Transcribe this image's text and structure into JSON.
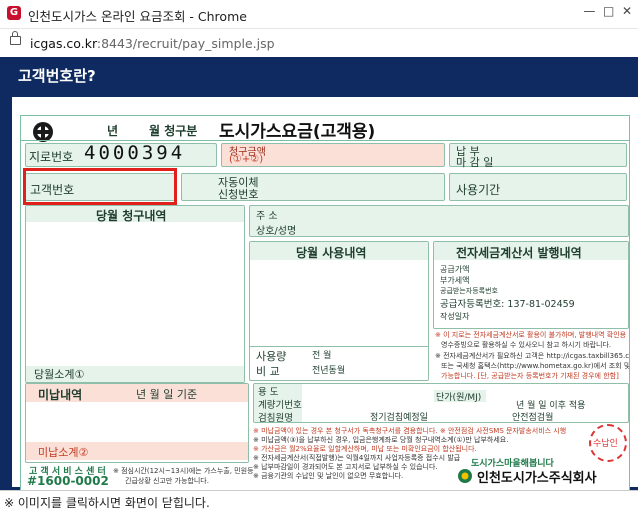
{
  "window": {
    "title": "인천도시가스 온라인 요금조회 - Chrome",
    "url_host": "icgas.co.kr",
    "url_path": ":8443/recruit/pay_simple.jsp"
  },
  "page": {
    "heading": "고객번호란?",
    "footer_note": "※ 이미지를 클릭하시면 화면이 닫힙니다."
  },
  "bill": {
    "header": {
      "year": "년",
      "month": "월 청구분",
      "title": "도시가스요금(고객용)"
    },
    "giro_label": "지로번호",
    "giro_digits": [
      "4",
      "0",
      "0",
      "0",
      "3",
      "9",
      "4"
    ],
    "charge_label": "청구금액",
    "charge_sub": "(①+②)",
    "due_label1": "납    부",
    "due_label2": "마 감 일",
    "customer_label": "고객번호",
    "autopay_label1": "자동이체",
    "autopay_label2": "신청번호",
    "period_label": "사용기간",
    "current_charges": "당월 청구내역",
    "address_label": "주    소",
    "name_label": "상호/성명",
    "usage_title": "당월 사용내역",
    "invoice_title": "전자세금계산서 발행내역",
    "invoice_lines": [
      "공급가액",
      "부가세액",
      "공급받는자등록번호",
      "공급자등록번호: 137-81-02459",
      "작성일자"
    ],
    "notice_lines": [
      "※ 이 지로는 전자세금계산서로 활용이 불가하며, 발행내역 확인용",
      "영수증빙으로 활용하실 수 있사오니 참고 하시기 바랍니다.",
      "※ 전자세금계산서가 필요하신 고객은 http://icgas.taxbill365.com",
      "또는 국세청 홈택스(http://www.hometax.go.kr)에서 조회 및 출력이",
      "가능합니다. [단, 공급받는자 등록번호가 기재된 경우에 한함]"
    ],
    "subtotal_label": "당월소계",
    "circle1": "①",
    "usage_label": "사용량",
    "compare_label": "비    교",
    "prev_month": "전    월",
    "prev_year_month": "전년동월",
    "unpaid_label": "미납내역",
    "unpaid_date": "년    월    일 기준",
    "unpaid_subtotal": "미납소계",
    "circle2": "②",
    "purpose_label": "용    도",
    "meter_label": "계량기번호",
    "unit_label": "단가(원/MJ)",
    "inspector_label": "검침원명",
    "inspect_date_label": "정기검침예정일",
    "safety_label": "안전점검월",
    "apply_after": "년    월    일 이후 적용",
    "center_label": "고 객 서 비 스 센 터",
    "center_phone": "#1600-0002",
    "center_note": "※ 점심시간(12시~13시)에는 가스누출, 민원등",
    "center_note2": "긴급상황 신고만 가능합니다.",
    "bottom_notes": [
      "※ 미납금액이 있는 경우 본 청구서가 독촉청구서를 겸용합니다.   ※ 안전점검 사전SMS 문자발송서비스 시행",
      "※ 미납금액(③)을 납부하신 경우, 입금은행계좌로 당월 청구내역소계(①)만 납부하세요.",
      "※ 가산금은 월2%요율로 일할계산하며, 미납 또는 미확인요금이 합산됩니다.",
      "※ 전자세금계산서(직접발행)는 익월4일까지 사업자등록증 접수시 발급",
      "※ 납부마감일이 경과되어도 본 고지서로 납부하실 수 있습니다.",
      "※ 금융기관의 수납인 및 날인이 없으면 무효합니다."
    ],
    "stamp_text": "수납인",
    "slogan": "도시가스마을해봅니다",
    "company": "인천도시가스주식회사"
  },
  "colors": {
    "highlight": "#e0201a",
    "page_bg": "#0e2a60",
    "bill_border": "#7cc0a4"
  }
}
